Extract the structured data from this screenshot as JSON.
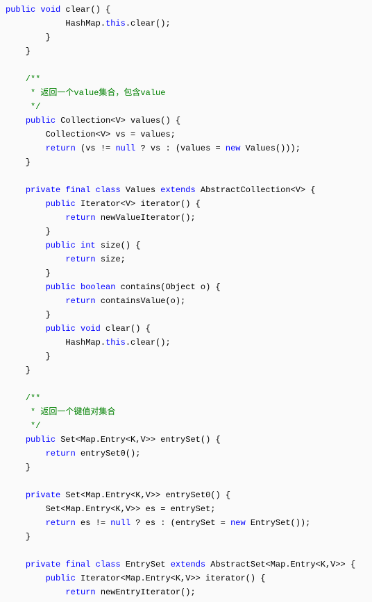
{
  "lines": [
    [
      {
        "t": "public",
        "c": "kw"
      },
      {
        "t": " "
      },
      {
        "t": "void",
        "c": "kw"
      },
      {
        "t": " clear() {"
      }
    ],
    [
      {
        "t": "            HashMap."
      },
      {
        "t": "this",
        "c": "kw"
      },
      {
        "t": ".clear();"
      }
    ],
    [
      {
        "t": "        }"
      }
    ],
    [
      {
        "t": "    }"
      }
    ],
    [
      {
        "t": ""
      }
    ],
    [
      {
        "t": "    /**",
        "c": "com"
      }
    ],
    [
      {
        "t": "     * 返回一个value集合，包含value",
        "c": "com"
      }
    ],
    [
      {
        "t": "     */",
        "c": "com"
      }
    ],
    [
      {
        "t": "    "
      },
      {
        "t": "public",
        "c": "kw"
      },
      {
        "t": " Collection<V> values() {"
      }
    ],
    [
      {
        "t": "        Collection<V> vs = values;"
      }
    ],
    [
      {
        "t": "        "
      },
      {
        "t": "return",
        "c": "kw"
      },
      {
        "t": " (vs != "
      },
      {
        "t": "null",
        "c": "kw"
      },
      {
        "t": " ? vs : (values = "
      },
      {
        "t": "new",
        "c": "kw"
      },
      {
        "t": " Values()));"
      }
    ],
    [
      {
        "t": "    }"
      }
    ],
    [
      {
        "t": ""
      }
    ],
    [
      {
        "t": "    "
      },
      {
        "t": "private",
        "c": "kw"
      },
      {
        "t": " "
      },
      {
        "t": "final",
        "c": "kw"
      },
      {
        "t": " "
      },
      {
        "t": "class",
        "c": "kw"
      },
      {
        "t": " Values "
      },
      {
        "t": "extends",
        "c": "kw"
      },
      {
        "t": " AbstractCollection<V> {"
      }
    ],
    [
      {
        "t": "        "
      },
      {
        "t": "public",
        "c": "kw"
      },
      {
        "t": " Iterator<V> iterator() {"
      }
    ],
    [
      {
        "t": "            "
      },
      {
        "t": "return",
        "c": "kw"
      },
      {
        "t": " newValueIterator();"
      }
    ],
    [
      {
        "t": "        }"
      }
    ],
    [
      {
        "t": "        "
      },
      {
        "t": "public",
        "c": "kw"
      },
      {
        "t": " "
      },
      {
        "t": "int",
        "c": "kw"
      },
      {
        "t": " size() {"
      }
    ],
    [
      {
        "t": "            "
      },
      {
        "t": "return",
        "c": "kw"
      },
      {
        "t": " size;"
      }
    ],
    [
      {
        "t": "        }"
      }
    ],
    [
      {
        "t": "        "
      },
      {
        "t": "public",
        "c": "kw"
      },
      {
        "t": " "
      },
      {
        "t": "boolean",
        "c": "kw"
      },
      {
        "t": " contains(Object o) {"
      }
    ],
    [
      {
        "t": "            "
      },
      {
        "t": "return",
        "c": "kw"
      },
      {
        "t": " containsValue(o);"
      }
    ],
    [
      {
        "t": "        }"
      }
    ],
    [
      {
        "t": "        "
      },
      {
        "t": "public",
        "c": "kw"
      },
      {
        "t": " "
      },
      {
        "t": "void",
        "c": "kw"
      },
      {
        "t": " clear() {"
      }
    ],
    [
      {
        "t": "            HashMap."
      },
      {
        "t": "this",
        "c": "kw"
      },
      {
        "t": ".clear();"
      }
    ],
    [
      {
        "t": "        }"
      }
    ],
    [
      {
        "t": "    }"
      }
    ],
    [
      {
        "t": ""
      }
    ],
    [
      {
        "t": "    /**",
        "c": "com"
      }
    ],
    [
      {
        "t": "     * 返回一个键值对集合",
        "c": "com"
      }
    ],
    [
      {
        "t": "     */",
        "c": "com"
      }
    ],
    [
      {
        "t": "    "
      },
      {
        "t": "public",
        "c": "kw"
      },
      {
        "t": " Set<Map.Entry<K,V>> entrySet() {"
      }
    ],
    [
      {
        "t": "        "
      },
      {
        "t": "return",
        "c": "kw"
      },
      {
        "t": " entrySet0();"
      }
    ],
    [
      {
        "t": "    }"
      }
    ],
    [
      {
        "t": ""
      }
    ],
    [
      {
        "t": "    "
      },
      {
        "t": "private",
        "c": "kw"
      },
      {
        "t": " Set<Map.Entry<K,V>> entrySet0() {"
      }
    ],
    [
      {
        "t": "        Set<Map.Entry<K,V>> es = entrySet;"
      }
    ],
    [
      {
        "t": "        "
      },
      {
        "t": "return",
        "c": "kw"
      },
      {
        "t": " es != "
      },
      {
        "t": "null",
        "c": "kw"
      },
      {
        "t": " ? es : (entrySet = "
      },
      {
        "t": "new",
        "c": "kw"
      },
      {
        "t": " EntrySet());"
      }
    ],
    [
      {
        "t": "    }"
      }
    ],
    [
      {
        "t": ""
      }
    ],
    [
      {
        "t": "    "
      },
      {
        "t": "private",
        "c": "kw"
      },
      {
        "t": " "
      },
      {
        "t": "final",
        "c": "kw"
      },
      {
        "t": " "
      },
      {
        "t": "class",
        "c": "kw"
      },
      {
        "t": " EntrySet "
      },
      {
        "t": "extends",
        "c": "kw"
      },
      {
        "t": " AbstractSet<Map.Entry<K,V>> {"
      }
    ],
    [
      {
        "t": "        "
      },
      {
        "t": "public",
        "c": "kw"
      },
      {
        "t": " Iterator<Map.Entry<K,V>> iterator() {"
      }
    ],
    [
      {
        "t": "            "
      },
      {
        "t": "return",
        "c": "kw"
      },
      {
        "t": " newEntryIterator();"
      }
    ]
  ]
}
